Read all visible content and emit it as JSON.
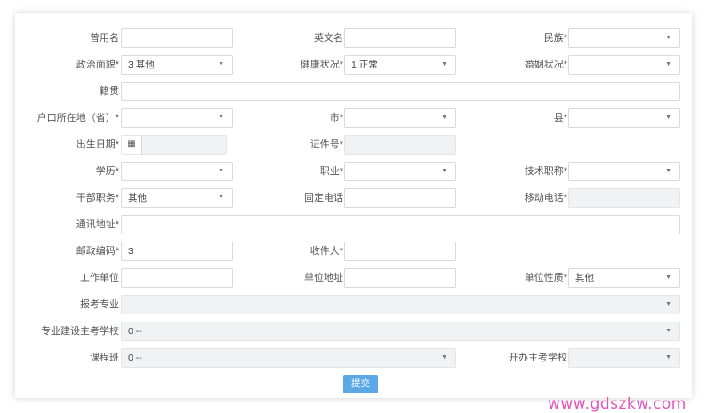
{
  "form": {
    "former_name": {
      "label": "曾用名",
      "value": ""
    },
    "english_name": {
      "label": "英文名",
      "value": ""
    },
    "ethnicity": {
      "label": "民族*",
      "value": ""
    },
    "political_status": {
      "label": "政治面貌*",
      "value": "3 其他"
    },
    "health_status": {
      "label": "健康状况*",
      "value": "1 正常"
    },
    "marital_status": {
      "label": "婚姻状况*",
      "value": ""
    },
    "native_place": {
      "label": "籍贯",
      "value": ""
    },
    "hukou_province": {
      "label": "户口所在地（省）*",
      "value": ""
    },
    "city": {
      "label": "市*",
      "value": ""
    },
    "county": {
      "label": "县*",
      "value": ""
    },
    "birth_date": {
      "label": "出生日期*",
      "value": ""
    },
    "id_number": {
      "label": "证件号*",
      "value": ""
    },
    "education": {
      "label": "学历*",
      "value": ""
    },
    "occupation": {
      "label": "职业*",
      "value": ""
    },
    "tech_title": {
      "label": "技术职称*",
      "value": ""
    },
    "cadre_position": {
      "label": "干部职务*",
      "value": "其他"
    },
    "landline": {
      "label": "固定电话",
      "value": ""
    },
    "mobile": {
      "label": "移动电话*",
      "value": ""
    },
    "address": {
      "label": "通讯地址*",
      "value": ""
    },
    "postcode": {
      "label": "邮政编码*",
      "value": "3"
    },
    "recipient": {
      "label": "收件人*",
      "value": ""
    },
    "work_unit": {
      "label": "工作单位",
      "value": ""
    },
    "unit_address": {
      "label": "单位地址",
      "value": ""
    },
    "unit_nature": {
      "label": "单位性质*",
      "value": "其他"
    },
    "major": {
      "label": "报考专业",
      "value": ""
    },
    "major_school": {
      "label": "专业建设主考学校",
      "value": "0 --"
    },
    "class_school": {
      "label": "课程班",
      "value": "0 --"
    },
    "host_school": {
      "label": "开办主考学校",
      "value": ""
    }
  },
  "submit_label": "提交",
  "watermark": "www.gdszkw.com"
}
